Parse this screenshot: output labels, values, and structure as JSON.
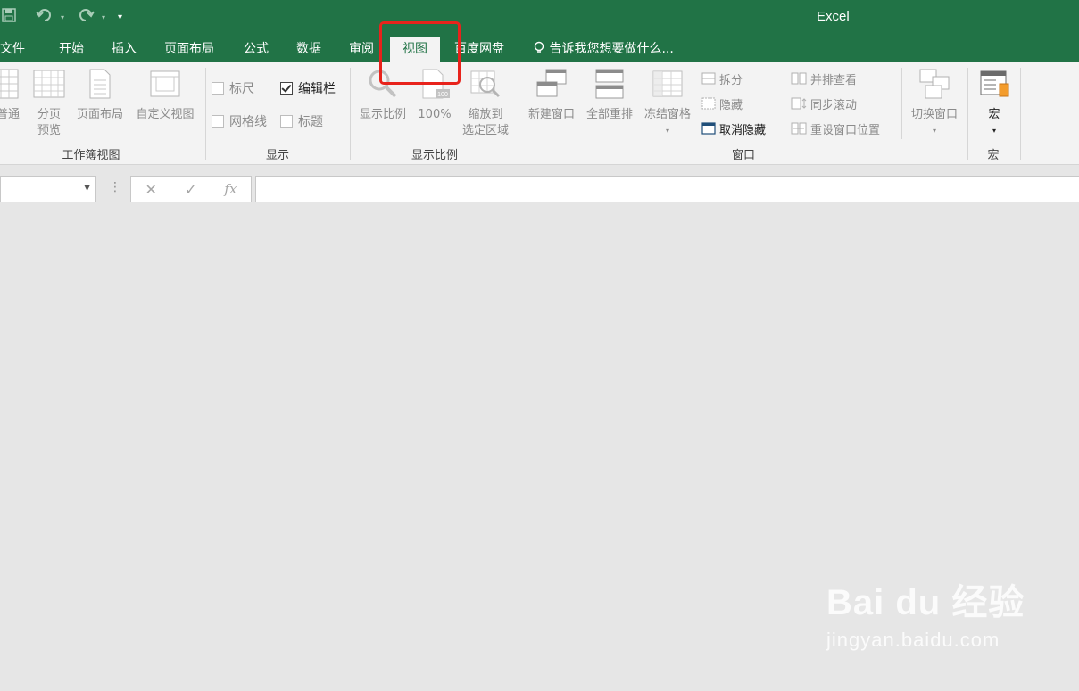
{
  "app": {
    "title": "Excel"
  },
  "qat": {
    "save": "save-icon",
    "undo": "undo-icon",
    "redo": "redo-icon",
    "customize": "customize-icon"
  },
  "tabs": [
    {
      "label": "文件"
    },
    {
      "label": "开始"
    },
    {
      "label": "插入"
    },
    {
      "label": "页面布局"
    },
    {
      "label": "公式"
    },
    {
      "label": "数据"
    },
    {
      "label": "审阅"
    },
    {
      "label": "视图"
    },
    {
      "label": "百度网盘"
    }
  ],
  "tell_me": "告诉我您想要做什么...",
  "ribbon": {
    "workbook_views": {
      "label": "工作簿视图",
      "buttons": [
        "普通",
        "分页\n预览",
        "页面布局",
        "自定义视图"
      ]
    },
    "show": {
      "label": "显示",
      "ruler": "标尺",
      "formula_bar": "编辑栏",
      "gridlines": "网格线",
      "headings": "标题"
    },
    "zoom": {
      "label": "显示比例",
      "zoom": "显示比例",
      "hundred": "100%",
      "zoom_selection": "缩放到\n选定区域"
    },
    "window": {
      "label": "窗口",
      "new_window": "新建窗口",
      "arrange_all": "全部重排",
      "freeze_panes": "冻结窗格",
      "split": "拆分",
      "hide": "隐藏",
      "unhide": "取消隐藏",
      "view_side_by_side": "并排查看",
      "sync_scroll": "同步滚动",
      "reset_position": "重设窗口位置",
      "switch_windows": "切换窗口"
    },
    "macros": {
      "label": "宏",
      "button": "宏"
    }
  },
  "formula_bar": {
    "cancel": "✕",
    "enter": "✓",
    "fx": "fx"
  },
  "watermark": {
    "brand": "Bai du 经验",
    "url": "jingyan.baidu.com"
  },
  "colors": {
    "accent": "#217346",
    "highlight": "#e8231c"
  }
}
